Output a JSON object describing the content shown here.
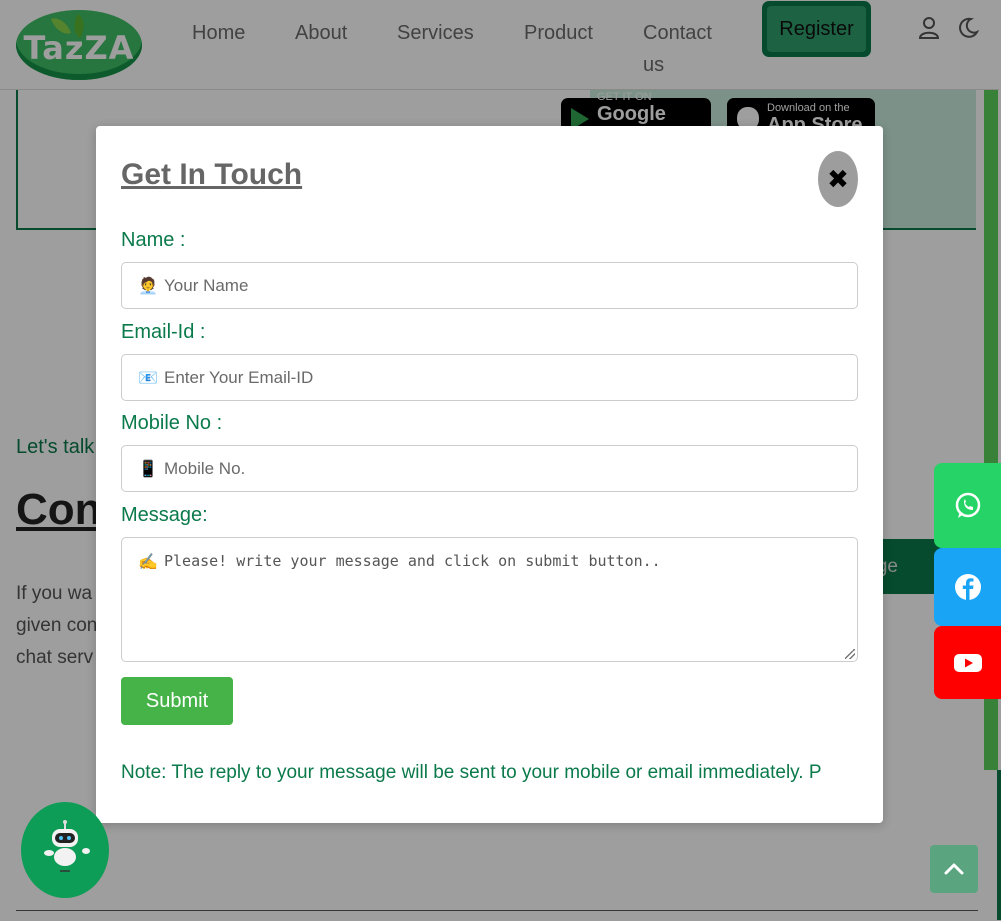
{
  "header": {
    "logo_text": "TazZA",
    "nav": {
      "home": "Home",
      "about": "About",
      "services": "Services",
      "product": "Product",
      "contact_line1": "Contact",
      "contact_line2": "us"
    },
    "register_label": "Register",
    "icons": [
      "user-icon",
      "moon-icon"
    ]
  },
  "hero": {
    "google_play_small": "GET IT ON",
    "google_play_big": "Google Play",
    "app_store_small": "Download on the",
    "app_store_big": "App Store"
  },
  "background": {
    "lets_talk": "Let's talk",
    "contact_heading": "Con",
    "para_line1": "If you wa",
    "para_line2": "given con",
    "para_line3": "chat serv",
    "green_button_fragment": "ge"
  },
  "modal": {
    "title": "Get In Touch",
    "close_symbol": "✖",
    "name_label": "Name :",
    "name_icon": "🧑‍💼",
    "name_placeholder": "Your Name",
    "email_label": "Email-Id :",
    "email_icon": "📧",
    "email_placeholder": "Enter Your Email-ID",
    "mobile_label": "Mobile No :",
    "mobile_icon": "📱",
    "mobile_placeholder": "Mobile No.",
    "message_label": "Message:",
    "message_icon": "✍️",
    "message_placeholder": "Please! write your message and click on submit button..",
    "submit_label": "Submit",
    "note": "Note: The reply to your message will be sent to your mobile or email immediately. P"
  },
  "floating": {
    "social": [
      "whatsapp-icon",
      "facebook-icon",
      "youtube-icon"
    ],
    "colors": {
      "whatsapp": "#25d366",
      "facebook": "#1aa4f5",
      "youtube": "#ff0000"
    }
  },
  "colors": {
    "brand_green": "#0b7a4b",
    "submit_green": "#45b347",
    "label_green": "#0b7a4b"
  }
}
